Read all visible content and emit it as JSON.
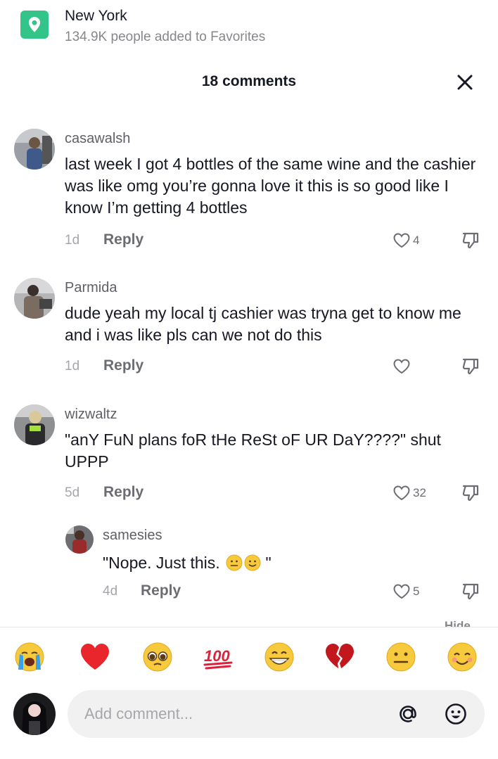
{
  "location": {
    "title": "New York",
    "subtitle": "134.9K people added to Favorites",
    "icon": "location-pin-icon",
    "accent": "#33c48a"
  },
  "comments_header": {
    "count_label": "18 comments",
    "close_icon": "close-icon"
  },
  "comments": [
    {
      "user": "casawalsh",
      "text": "last week I got 4 bottles of the same wine and the cashier was like omg you’re gonna love it this is so good like I know I’m getting 4 bottles",
      "age": "1d",
      "reply_label": "Reply",
      "likes": "4"
    },
    {
      "user": "Parmida",
      "text": "dude yeah my local tj cashier was tryna get to know me and i was like pls can we not do this",
      "age": "1d",
      "reply_label": "Reply",
      "likes": ""
    },
    {
      "user": "wizwaltz",
      "text": "\"anY FuN plans foR tHe ReSt oF UR DaY????\" shut UPPP",
      "age": "5d",
      "reply_label": "Reply",
      "likes": "32"
    }
  ],
  "reply": {
    "user": "samesies",
    "text_before": "\"Nope. Just this.",
    "text_after": "\"",
    "age": "4d",
    "reply_label": "Reply",
    "likes": "5"
  },
  "hide_label": "Hide",
  "emoji_bar": [
    "loudly-crying-face",
    "red-heart",
    "pleading-face",
    "hundred-points",
    "grinning-face",
    "broken-heart",
    "neutral-face",
    "smiling-face"
  ],
  "composer": {
    "placeholder": "Add comment...",
    "mention_icon": "at-sign-icon",
    "emoji_icon": "smiley-icon"
  }
}
